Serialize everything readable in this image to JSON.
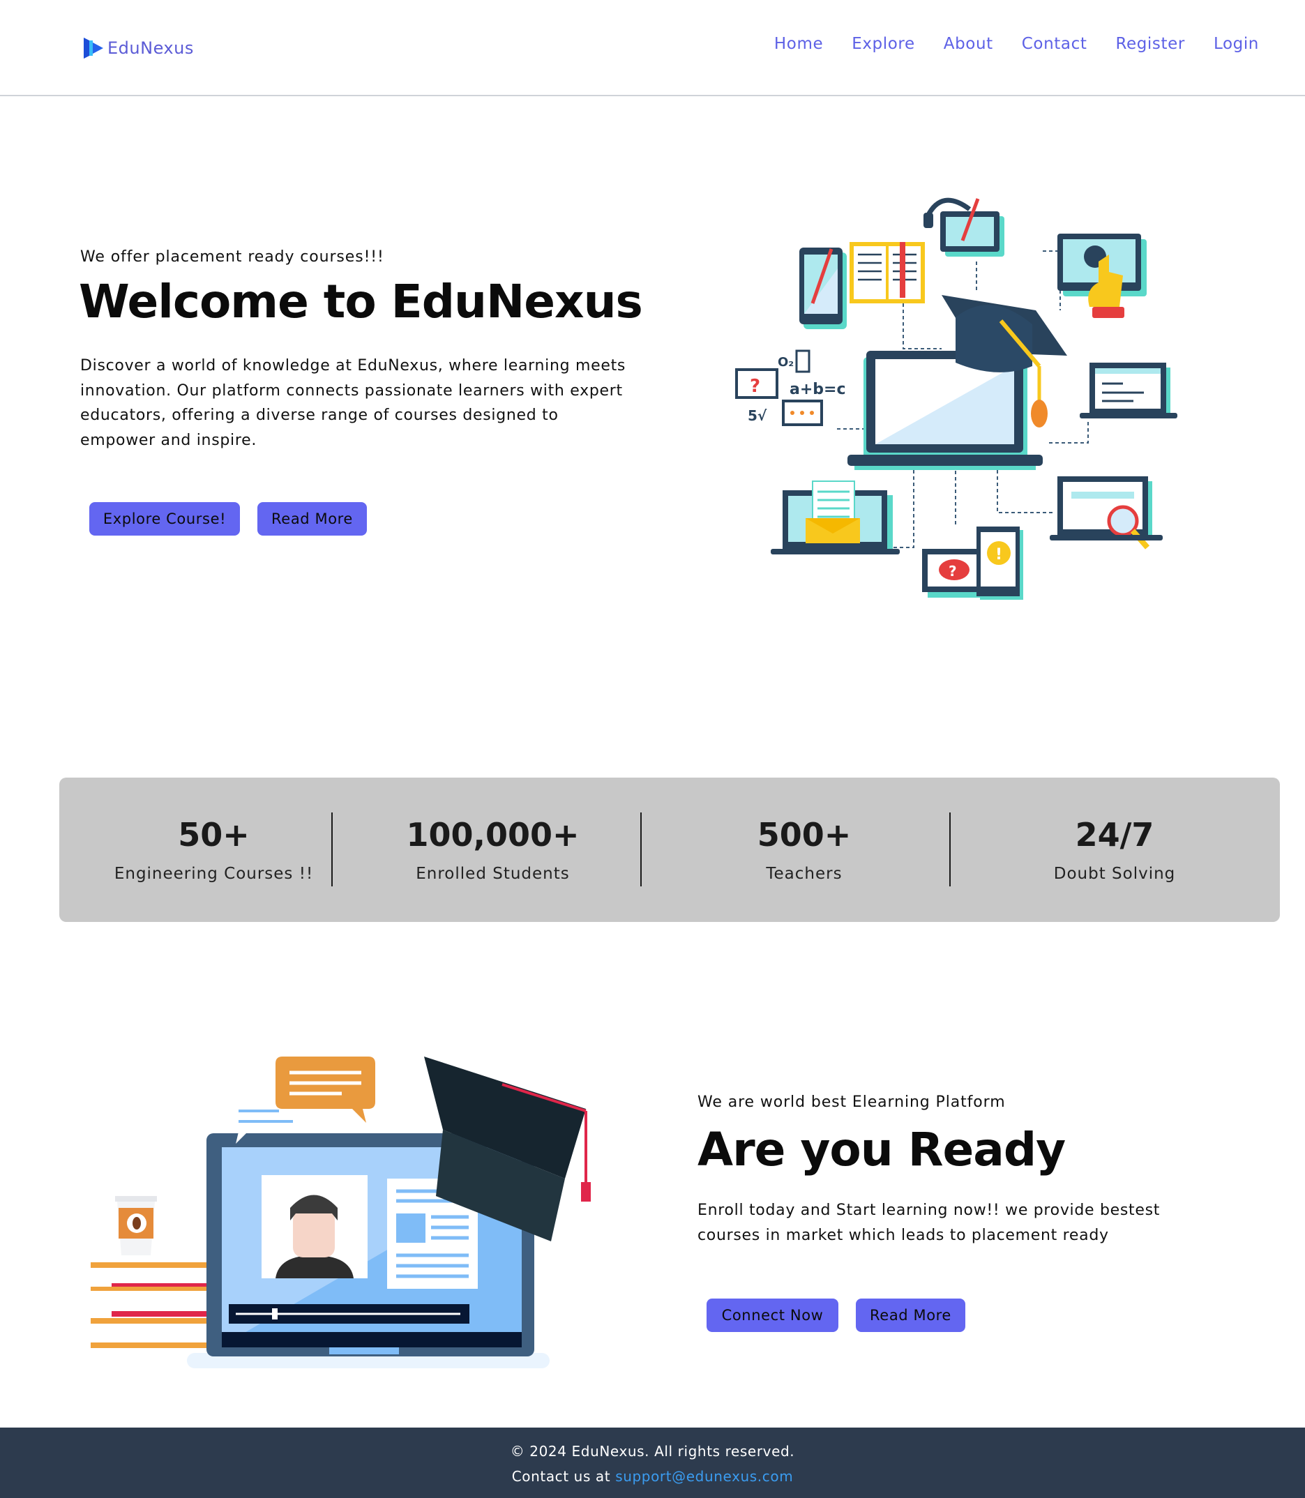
{
  "brand": {
    "name": "EduNexus",
    "logo_icon": "play-book-icon",
    "color_nav": "#5d61e6"
  },
  "nav": {
    "items": [
      "Home",
      "Explore",
      "About",
      "Contact",
      "Register",
      "Login"
    ]
  },
  "hero": {
    "tagline": "We offer placement ready courses!!!",
    "title": "Welcome to EduNexus",
    "description": "Discover a world of knowledge at EduNexus, where learning meets innovation. Our platform connects passionate learners with expert educators, offering a diverse range of courses designed to empower and inspire.",
    "primary_button": "Explore Course!",
    "secondary_button": "Read More",
    "illustration": "elearning-network-illustration"
  },
  "stats": [
    {
      "value": "50+",
      "label": "Engineering Courses !!"
    },
    {
      "value": "100,000+",
      "label": "Enrolled Students"
    },
    {
      "value": "500+",
      "label": "Teachers"
    },
    {
      "value": "24/7",
      "label": "Doubt Solving"
    }
  ],
  "section2": {
    "tagline": "We are world best Elearning Platform",
    "title": "Are you Ready",
    "description": "Enroll today and Start learning now!! we provide bestest courses in market which leads to placement ready",
    "primary_button": "Connect Now",
    "secondary_button": "Read More",
    "illustration": "online-class-laptop-illustration"
  },
  "footer": {
    "copyright": "© 2024 EduNexus. All rights reserved.",
    "contact_prefix": "Contact us at ",
    "email": "support@edunexus.com"
  },
  "colors": {
    "button": "#6366f1",
    "stats_bg": "#c8c8c8",
    "footer_bg": "#2d3b4e",
    "footer_link": "#3b9cf0"
  }
}
